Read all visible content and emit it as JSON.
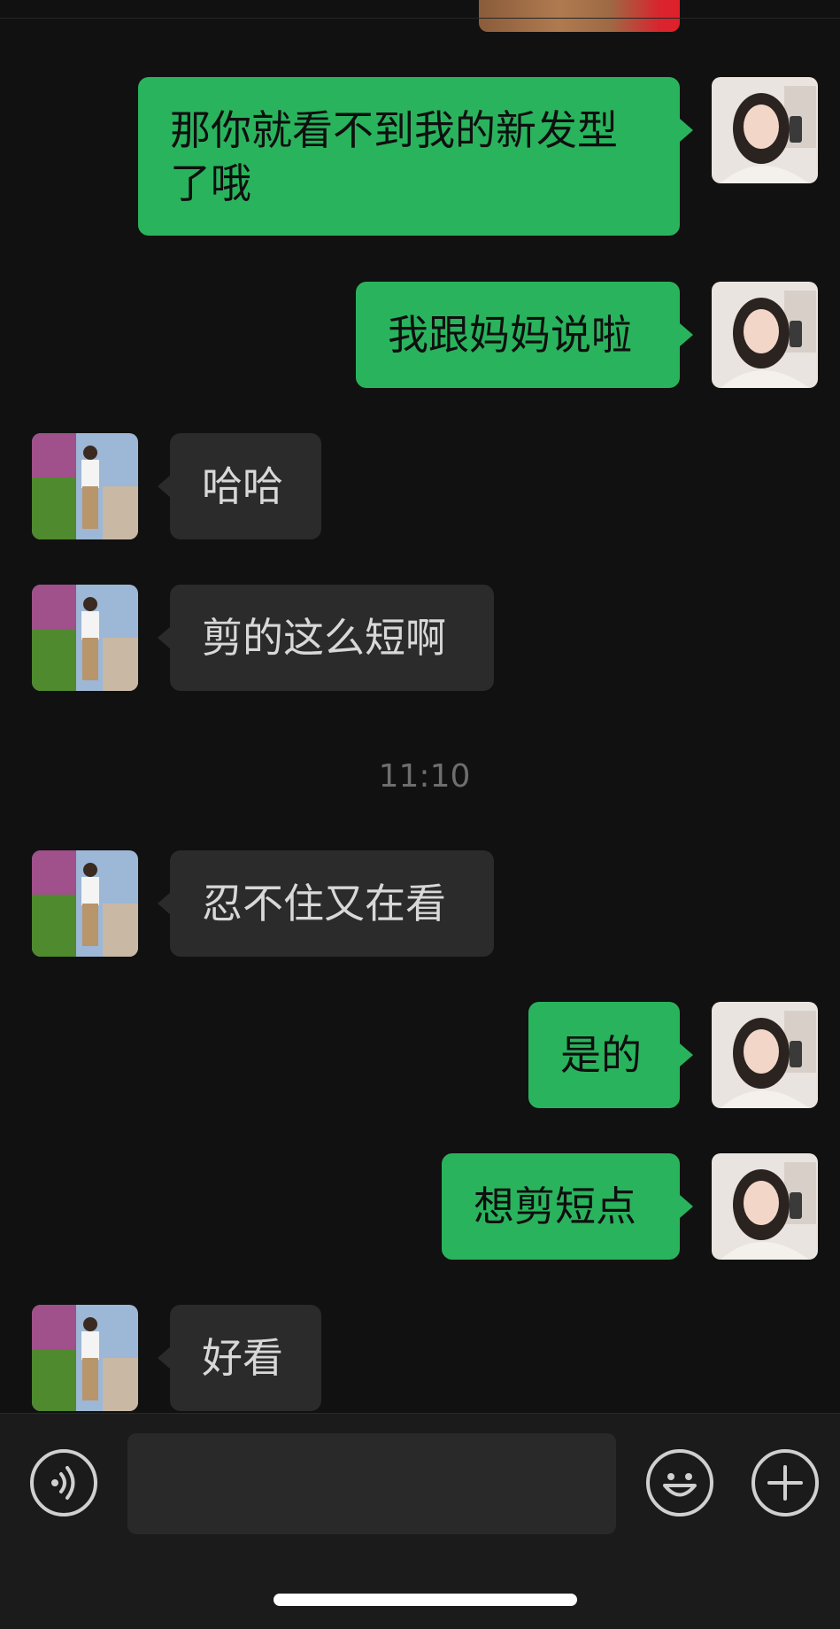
{
  "messages": [
    {
      "side": "out",
      "text": "那你就看不到我的新发型\n了哦"
    },
    {
      "side": "out",
      "text": "我跟妈妈说啦"
    },
    {
      "side": "in",
      "text": "哈哈"
    },
    {
      "side": "in",
      "text": "剪的这么短啊"
    },
    {
      "side": "in",
      "text": "忍不住又在看"
    },
    {
      "side": "out",
      "text": "是的"
    },
    {
      "side": "out",
      "text": "想剪短点"
    },
    {
      "side": "in",
      "text": "好看"
    }
  ],
  "timestamp": "11:10",
  "input": {
    "value": "",
    "voice_icon": "voice-icon",
    "emoji_icon": "emoji-icon",
    "plus_icon": "plus-icon"
  },
  "colors": {
    "background": "#111111",
    "outgoing_bubble": "#2ab35d",
    "incoming_bubble": "#2b2b2b"
  }
}
